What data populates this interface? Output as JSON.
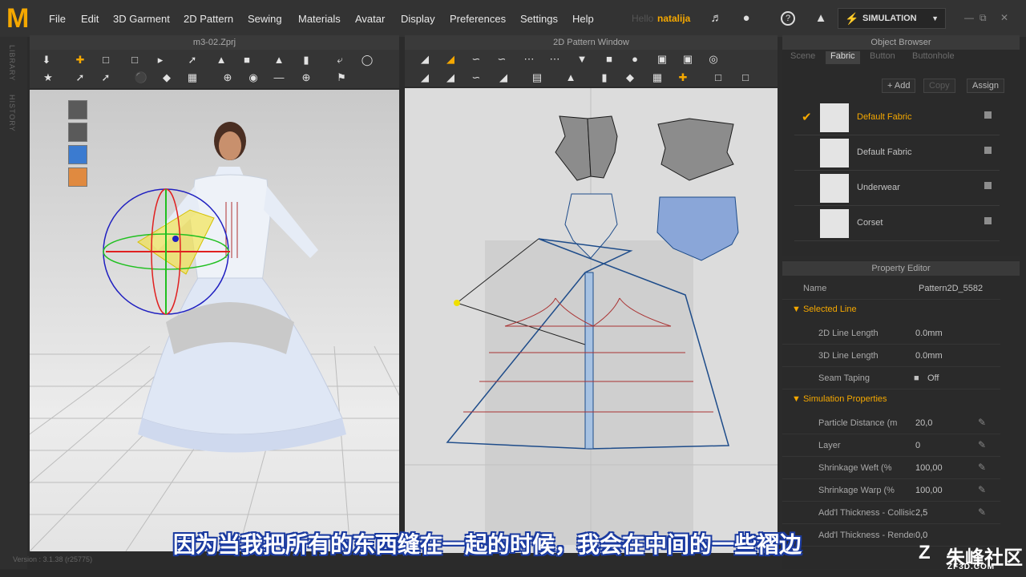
{
  "app": {
    "logo_letter": "M",
    "accent": "#f5a800"
  },
  "menu": [
    "File",
    "Edit",
    "3D Garment",
    "2D Pattern",
    "Sewing",
    "Materials",
    "Avatar",
    "Display",
    "Preferences",
    "Settings",
    "Help"
  ],
  "user": {
    "prefix": "Hello",
    "name": "natalija"
  },
  "simulation": {
    "label": "SIMULATION"
  },
  "sidebar": {
    "library": "LIBRARY",
    "history": "HISTORY"
  },
  "view3d": {
    "title": "m3-02.Zprj"
  },
  "view2d": {
    "title": "2D Pattern Window"
  },
  "object_browser": {
    "title": "Object Browser",
    "tabs": [
      "Scene",
      "Fabric",
      "Button",
      "Buttonhole"
    ],
    "active_tab": "Fabric",
    "actions": {
      "add": "Add",
      "copy": "Copy",
      "assign": "Assign"
    },
    "fabrics": [
      {
        "name": "Default Fabric",
        "selected": true
      },
      {
        "name": "Default Fabric",
        "selected": false
      },
      {
        "name": "Underwear",
        "selected": false
      },
      {
        "name": "Corset",
        "selected": false
      }
    ]
  },
  "property_editor": {
    "title": "Property Editor",
    "name_label": "Name",
    "name_value": "Pattern2D_5582",
    "sections": {
      "selected_line": "Selected Line",
      "simulation": "Simulation Properties"
    },
    "selected_line": [
      {
        "label": "2D Line Length",
        "value": "0.0mm"
      },
      {
        "label": "3D Line Length",
        "value": "0.0mm"
      },
      {
        "label": "Seam Taping",
        "value": "Off"
      }
    ],
    "simulation": [
      {
        "label": "Particle Distance (m",
        "value": "20,0"
      },
      {
        "label": "Layer",
        "value": "0"
      },
      {
        "label": "Shrinkage Weft (%",
        "value": "100,00"
      },
      {
        "label": "Shrinkage Warp (%",
        "value": "100,00"
      },
      {
        "label": "Add'l Thickness - Collisic",
        "value": "2,5"
      },
      {
        "label": "Add'l Thickness - Render",
        "value": "0,0"
      }
    ]
  },
  "subtitle": "因为当我把所有的东西缝在一起的时候，我会在中间的一些褶边",
  "watermark": {
    "text": "朱峰社区",
    "domain": "ZF3D.COM"
  },
  "version": "Version : 3.1.38 (r25775)"
}
